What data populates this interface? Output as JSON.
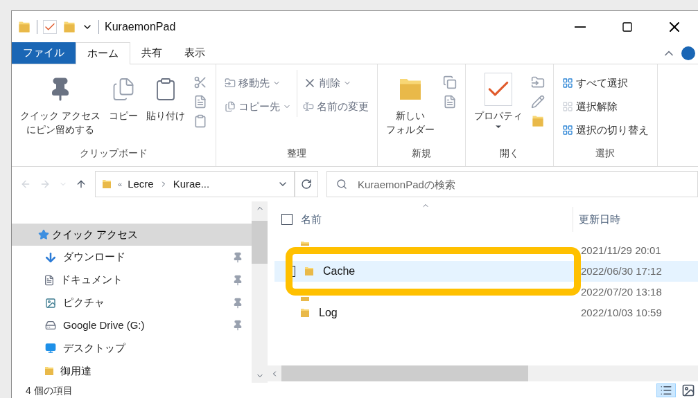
{
  "window": {
    "title": "KuraemonPad"
  },
  "ribbon_tabs": [
    {
      "label": "ファイル",
      "kind": "file",
      "selected": false
    },
    {
      "label": "ホーム",
      "kind": "tab",
      "selected": true
    },
    {
      "label": "共有",
      "kind": "tab",
      "selected": false
    },
    {
      "label": "表示",
      "kind": "tab",
      "selected": false
    }
  ],
  "ribbon_groups": [
    {
      "label": "クリップボード",
      "items": [
        {
          "kind": "large",
          "lines": [
            "クイック アクセス",
            "にピン留めする"
          ]
        },
        {
          "kind": "large",
          "lines": [
            "コピー"
          ]
        },
        {
          "kind": "large",
          "lines": [
            "貼り付け"
          ]
        },
        {
          "kind": "icons"
        }
      ]
    },
    {
      "label": "整理",
      "items": [
        {
          "kind": "column",
          "entries": [
            {
              "label": "移動先",
              "dropdown": true
            },
            {
              "label": "コピー先",
              "dropdown": true
            }
          ]
        },
        {
          "kind": "column",
          "entries": [
            {
              "label": "削除",
              "dropdown": true
            },
            {
              "label": "名前の変更",
              "dropdown": false
            }
          ]
        }
      ]
    },
    {
      "label": "新規",
      "items": [
        {
          "kind": "large",
          "lines": [
            "新しい",
            "フォルダー"
          ]
        },
        {
          "kind": "icons"
        }
      ]
    },
    {
      "label": "開く",
      "items": [
        {
          "kind": "large",
          "lines": [
            "プロパティ"
          ]
        },
        {
          "kind": "icons"
        }
      ]
    },
    {
      "label": "選択",
      "items": [
        {
          "kind": "column",
          "entries": [
            {
              "label": "すべて選択",
              "dropdown": false
            },
            {
              "label": "選択解除",
              "dropdown": false
            },
            {
              "label": "選択の切り替え",
              "dropdown": false
            }
          ]
        }
      ]
    }
  ],
  "address": {
    "separator": "«",
    "crumbs": [
      "Lecre",
      "Kurae..."
    ]
  },
  "search": {
    "placeholder": "KuraemonPadの検索"
  },
  "sidebar": {
    "items": [
      {
        "label": "クイック アクセス",
        "selected": true,
        "pinned": false,
        "children": [
          {
            "label": "ダウンロード",
            "selected": false,
            "pinned": true
          },
          {
            "label": "ドキュメント",
            "selected": false,
            "pinned": true
          },
          {
            "label": "ピクチャ",
            "selected": false,
            "pinned": true
          },
          {
            "label": "Google Drive (G:)",
            "selected": false,
            "pinned": true
          },
          {
            "label": "デスクトップ",
            "selected": false,
            "pinned": false
          },
          {
            "label": "御用達",
            "selected": false,
            "pinned": false
          }
        ]
      }
    ]
  },
  "table": {
    "columns": [
      "名前",
      "更新日時"
    ],
    "all_checked": false,
    "rows": [
      {
        "date": "2021/11/29 20:01",
        "selected": false
      },
      {
        "name": "Cache",
        "date": "2022/06/30 17:12",
        "selected": true
      },
      {
        "date": "2022/07/20 13:18",
        "selected": false
      },
      {
        "name": "Log",
        "date": "2022/10/03 10:59",
        "selected": false
      }
    ]
  },
  "status_bar": {
    "count": "4 個の項目"
  }
}
